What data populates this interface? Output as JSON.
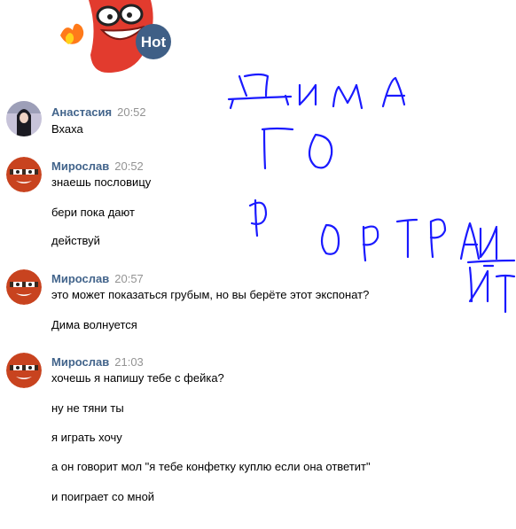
{
  "sticker": {
    "badge": "Hot"
  },
  "messages": [
    {
      "author": "Анастасия",
      "time": "20:52",
      "avatar": "photo-avatar",
      "lines": [
        "Вхаха"
      ]
    },
    {
      "author": "Мирослав",
      "time": "20:52",
      "avatar": "cartoon-avatar",
      "lines": [
        "знаешь пословицу",
        "бери пока дают",
        "действуй"
      ]
    },
    {
      "author": "Мирослав",
      "time": "20:57",
      "avatar": "cartoon-avatar",
      "lines": [
        "это может показаться грубым, но вы берёте этот экспонат?",
        "Дима волнуется"
      ]
    },
    {
      "author": "Мирослав",
      "time": "21:03",
      "avatar": "cartoon-avatar",
      "lines": [
        "хочешь я напишу тебе с фейка?",
        "ну не тяни ты",
        "я играть хочу",
        "а он говорит мол \"я тебе конфетку куплю если она ответит\"",
        "и поиграет со мной"
      ]
    }
  ],
  "colors": {
    "author": "#42648b",
    "time": "#939393",
    "ink": "#1a1aff",
    "sticker_red": "#e23b2e"
  }
}
